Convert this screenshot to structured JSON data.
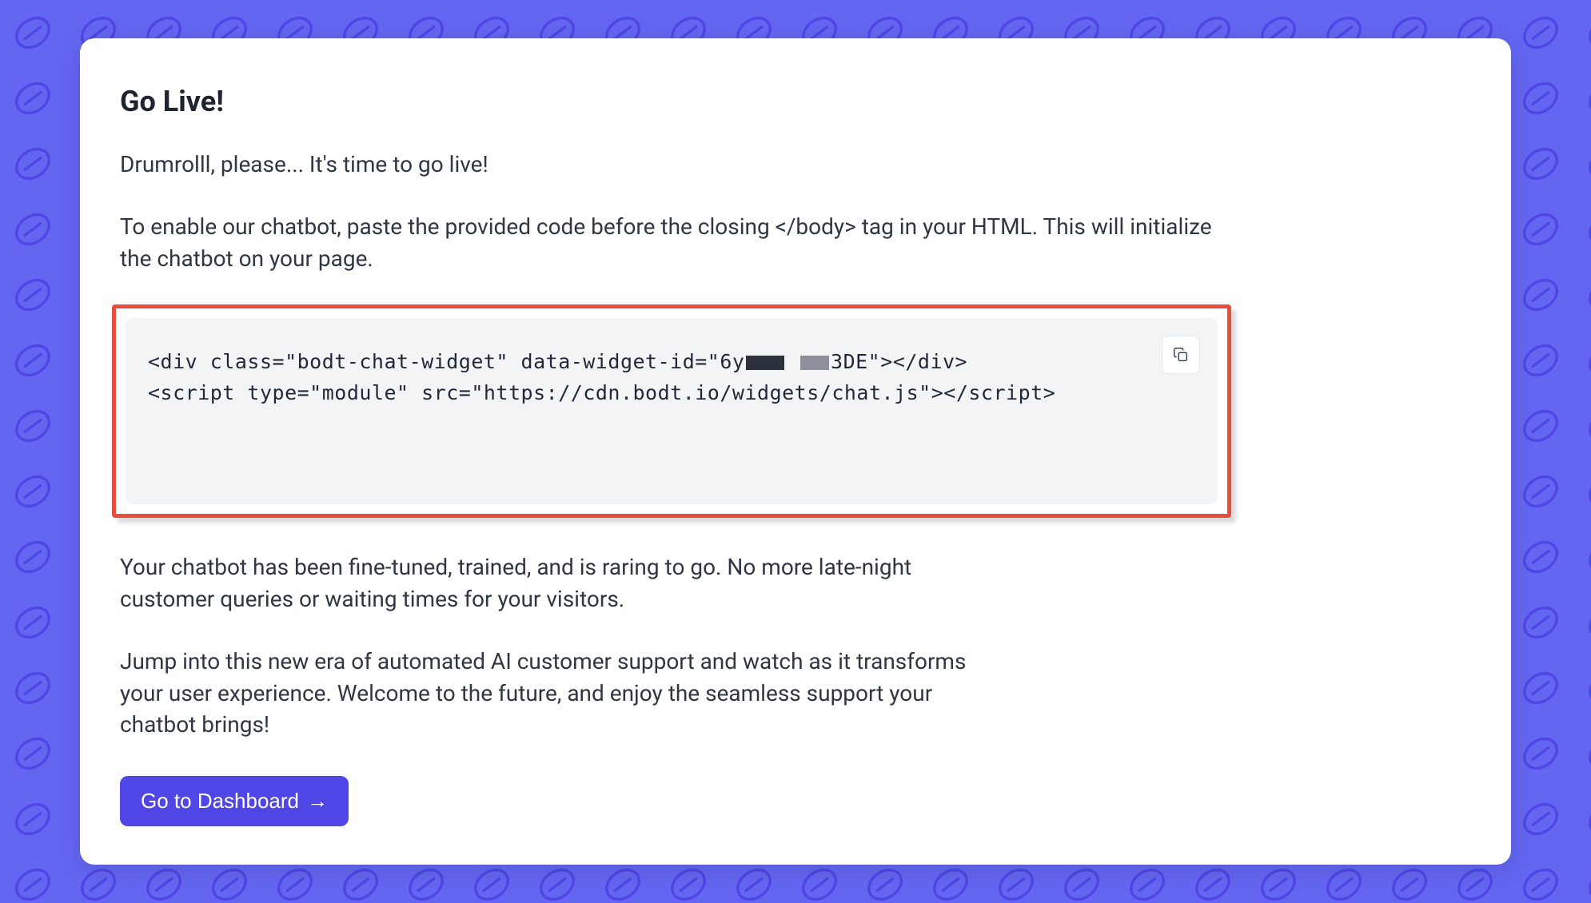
{
  "card": {
    "title": "Go Live!",
    "intro": "Drumrolll, please... It's time to go live!",
    "instruction": "To enable our chatbot, paste the provided code before the closing </body> tag in your HTML. This will initialize the chatbot on your page.",
    "code_line1_prefix": "<div class=\"bodt-chat-widget\" data-widget-id=\"6y",
    "code_line1_mid_redacted": "[redacted]",
    "code_line1_suffix": "3DE\"></div>",
    "code_line2": "<script type=\"module\" src=\"https://cdn.bodt.io/widgets/chat.js\"></script>",
    "after1": "Your chatbot has been fine-tuned, trained, and is raring to go. No more late-night customer queries or waiting times for your visitors.",
    "after2": "Jump into this new era of automated AI customer support and watch as it transforms your user experience. Welcome to the future, and enjoy the seamless support your chatbot brings!",
    "cta": "Go to Dashboard",
    "cta_arrow": "→",
    "copy_icon_name": "copy-icon"
  }
}
